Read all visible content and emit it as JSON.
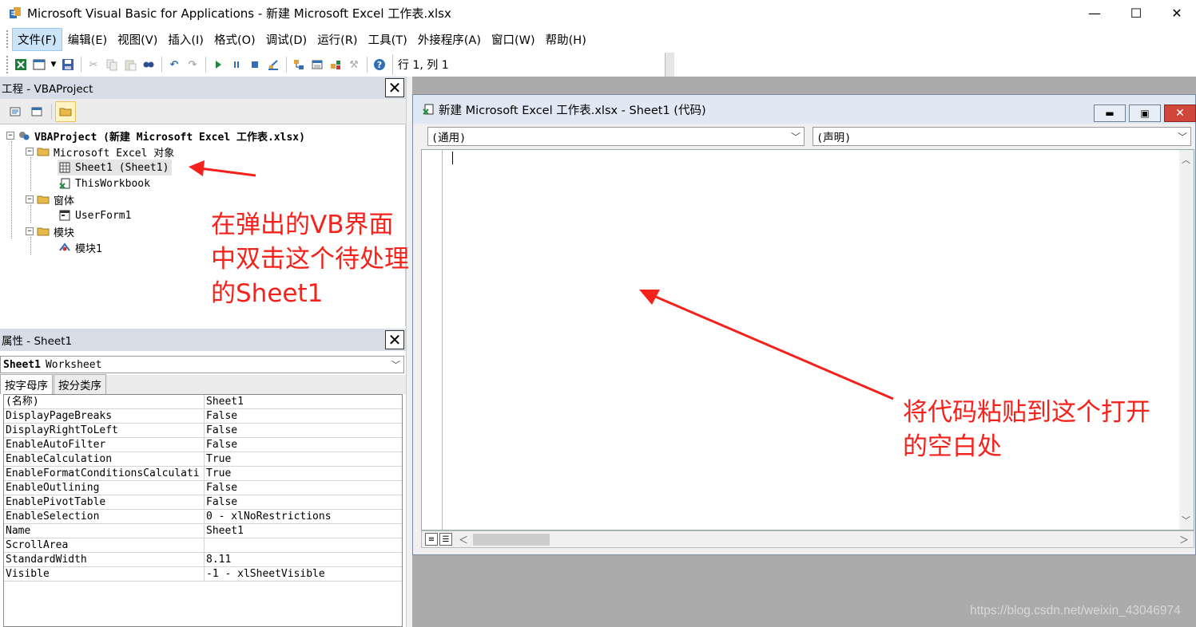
{
  "window": {
    "title": "Microsoft Visual Basic for Applications - 新建 Microsoft Excel 工作表.xlsx",
    "controls": {
      "minimize": "—",
      "maximize": "☐",
      "close": "✕"
    }
  },
  "menu": [
    "文件(F)",
    "编辑(E)",
    "视图(V)",
    "插入(I)",
    "格式(O)",
    "调试(D)",
    "运行(R)",
    "工具(T)",
    "外接程序(A)",
    "窗口(W)",
    "帮助(H)"
  ],
  "toolbar": {
    "icons": [
      "view-excel-icon",
      "insert-userform-icon",
      "dropdown-icon",
      "save-icon",
      "cut-icon",
      "copy-icon",
      "paste-icon",
      "find-icon",
      "undo-icon",
      "redo-icon",
      "run-icon",
      "break-icon",
      "reset-icon",
      "design-mode-icon",
      "project-explorer-icon",
      "properties-icon",
      "object-browser-icon",
      "toolbox-icon",
      "help-icon"
    ],
    "position_label": "行 1, 列 1"
  },
  "project_panel": {
    "title": "工程 - VBAProject",
    "close": "✕",
    "tree": {
      "root": "VBAProject (新建 Microsoft Excel 工作表.xlsx)",
      "excel_objects_folder": "Microsoft Excel 对象",
      "sheet1": "Sheet1 (Sheet1)",
      "this_workbook": "ThisWorkbook",
      "forms_folder": "窗体",
      "userform1": "UserForm1",
      "modules_folder": "模块",
      "module1": "模块1"
    }
  },
  "properties_panel": {
    "title": "属性 - Sheet1",
    "close": "✕",
    "object_name": "Sheet1",
    "object_type": "Worksheet",
    "tabs": [
      "按字母序",
      "按分类序"
    ],
    "rows": [
      [
        "(名称)",
        "Sheet1"
      ],
      [
        "DisplayPageBreaks",
        "False"
      ],
      [
        "DisplayRightToLeft",
        "False"
      ],
      [
        "EnableAutoFilter",
        "False"
      ],
      [
        "EnableCalculation",
        "True"
      ],
      [
        "EnableFormatConditionsCalculati",
        "True"
      ],
      [
        "EnableOutlining",
        "False"
      ],
      [
        "EnablePivotTable",
        "False"
      ],
      [
        "EnableSelection",
        "0 - xlNoRestrictions"
      ],
      [
        "Name",
        "Sheet1"
      ],
      [
        "ScrollArea",
        ""
      ],
      [
        "StandardWidth",
        "8.11"
      ],
      [
        "Visible",
        "-1 - xlSheetVisible"
      ]
    ]
  },
  "code_window": {
    "title": "新建 Microsoft Excel 工作表.xlsx - Sheet1 (代码)",
    "object_combo": "(通用)",
    "procedure_combo": "(声明)",
    "controls": {
      "minimize": "▬",
      "maximize": "▣",
      "close": "✕"
    }
  },
  "annotations": {
    "left": [
      "在弹出的VB界面",
      "中双击这个待处理",
      "的Sheet1"
    ],
    "right": [
      "将代码粘贴到这个打开",
      "的空白处"
    ],
    "color": "#f5211b"
  },
  "watermark": "https://blog.csdn.net/weixin_43046974"
}
